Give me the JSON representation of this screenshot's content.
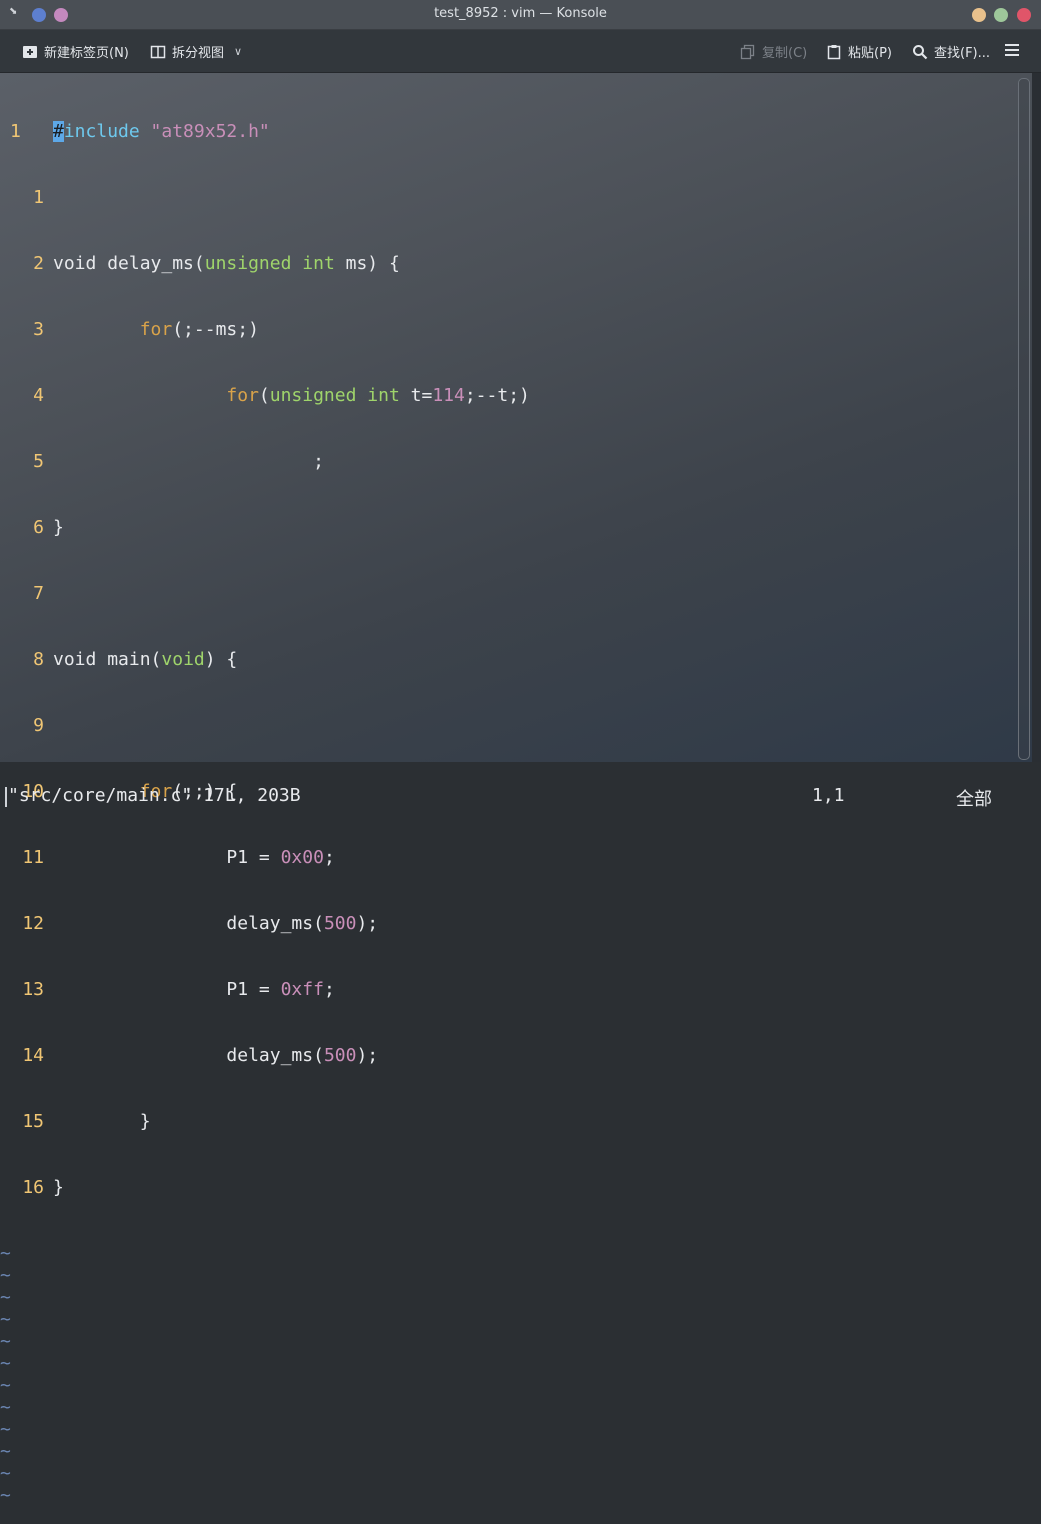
{
  "window": {
    "title": "test_8952 : vim — Konsole"
  },
  "toolbar": {
    "new_tab": "新建标签页(N)",
    "split_view": "拆分视图",
    "copy": "复制(C)",
    "paste": "粘贴(P)",
    "find": "查找(F)...",
    "menu_icon": "hamburger-icon"
  },
  "editor": {
    "lines": [
      {
        "n": "1",
        "text": "#include \"at89x52.h\""
      },
      {
        "n": "1",
        "text": ""
      },
      {
        "n": "2",
        "text": "void delay_ms(unsigned int ms) {"
      },
      {
        "n": "3",
        "text": "        for(;--ms;)"
      },
      {
        "n": "4",
        "text": "                for(unsigned int t=114;--t;)"
      },
      {
        "n": "5",
        "text": "                        ;"
      },
      {
        "n": "6",
        "text": "}"
      },
      {
        "n": "7",
        "text": ""
      },
      {
        "n": "8",
        "text": "void main(void) {"
      },
      {
        "n": "9",
        "text": ""
      },
      {
        "n": "10",
        "text": "        for(;;) {"
      },
      {
        "n": "11",
        "text": "                P1 = 0x00;"
      },
      {
        "n": "12",
        "text": "                delay_ms(500);"
      },
      {
        "n": "13",
        "text": "                P1 = 0xff;"
      },
      {
        "n": "14",
        "text": "                delay_ms(500);"
      },
      {
        "n": "15",
        "text": "        }"
      },
      {
        "n": "16",
        "text": "}"
      }
    ],
    "empty_marker": "~",
    "empty_lines": 12
  },
  "status": {
    "file_info": "\"src/core/main.c\" 17L, 203B",
    "position": "1,1",
    "percent": "全部"
  },
  "colors": {
    "line_number": "#f0c674",
    "type_keyword": "#9fd46b",
    "control_keyword": "#d9a34a",
    "number": "#c98fb9",
    "preprocessor": "#6ec9ee",
    "tilde": "#6b86b3",
    "close_button": "#e05569"
  }
}
